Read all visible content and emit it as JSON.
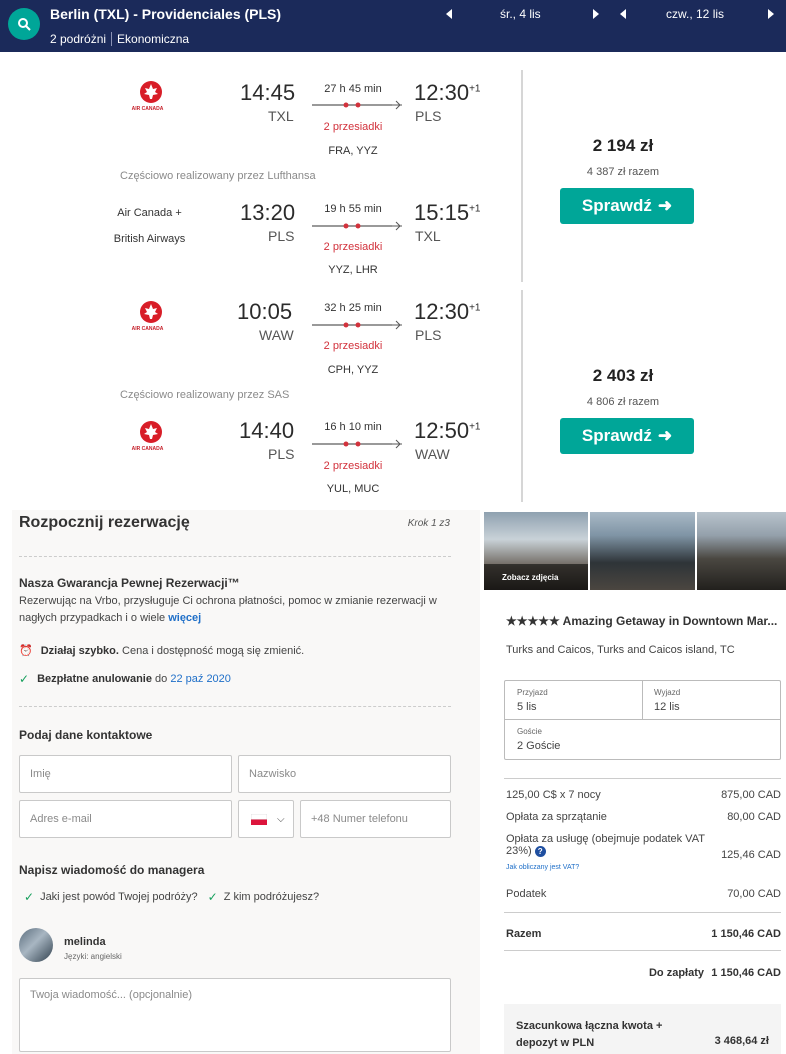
{
  "search": {
    "route": "Berlin (TXL) - Providenciales (PLS)",
    "travelers": "2 podróżni",
    "cabin": "Ekonomiczna",
    "depart_date": "śr., 4 lis",
    "return_date": "czw., 12 lis"
  },
  "results": [
    {
      "operated_by": "Częściowo realizowany przez Lufthansa",
      "price": "2 194 zł",
      "price_total": "4 387 zł razem",
      "book_label": "Sprawdź",
      "outbound": {
        "airline_logo": "air-canada-logo",
        "airline_text": "AIR CANADA",
        "depart_time": "14:45",
        "depart_code": "TXL",
        "duration": "27 h 45 min",
        "stops": "2 przesiadki",
        "arrive_time": "12:30",
        "arrive_offset": "+1",
        "arrive_code": "PLS",
        "via": "FRA, YYZ"
      },
      "inbound": {
        "airline_name": "Air Canada +",
        "airline_name2": "British Airways",
        "depart_time": "13:20",
        "depart_code": "PLS",
        "duration": "19 h 55 min",
        "stops": "2 przesiadki",
        "arrive_time": "15:15",
        "arrive_offset": "+1",
        "arrive_code": "TXL",
        "via": "YYZ, LHR"
      }
    },
    {
      "operated_by": "Częściowo realizowany przez SAS",
      "price": "2 403 zł",
      "price_total": "4 806 zł razem",
      "book_label": "Sprawdź",
      "outbound": {
        "airline_logo": "air-canada-logo",
        "airline_text": "AIR CANADA",
        "depart_time": "10:05",
        "depart_code": "WAW",
        "duration": "32 h 25 min",
        "stops": "2 przesiadki",
        "arrive_time": "12:30",
        "arrive_offset": "+1",
        "arrive_code": "PLS",
        "via": "CPH, YYZ"
      },
      "inbound": {
        "airline_logo": "air-canada-logo",
        "airline_text": "AIR CANADA",
        "depart_time": "14:40",
        "depart_code": "PLS",
        "duration": "16 h 10 min",
        "stops": "2 przesiadki",
        "arrive_time": "12:50",
        "arrive_offset": "+1",
        "arrive_code": "WAW",
        "via": "YUL, MUC"
      }
    }
  ],
  "booking": {
    "title": "Rozpocznij rezerwację",
    "step": "Krok 1 z3",
    "guarantee_title": "Nasza Gwarancja Pewnej Rezerwacji™",
    "guarantee_text": "Rezerwując na Vrbo, przysługuje Ci ochrona płatności, pomoc w zmianie rezerwacji w nagłych przypadkach i o wiele ",
    "guarantee_link": "więcej",
    "act_fast_bold": "Działaj szybko.",
    "act_fast_text": "Cena i dostępność mogą się zmienić.",
    "free_cancel_bold": "Bezpłatne anulowanie",
    "free_cancel_text": "do",
    "free_cancel_date": "22 paź 2020",
    "contact_title": "Podaj dane kontaktowe",
    "first_name_ph": "Imię",
    "last_name_ph": "Nazwisko",
    "email_ph": "Adres e-mail",
    "phone_ph": "+48 Numer telefonu",
    "message_title": "Napisz wiadomość do managera",
    "prompt1": "Jaki jest powód Twojej podróży?",
    "prompt2": "Z kim podróżujesz?",
    "manager_name": "melinda",
    "manager_lang": "Języki: angielski",
    "message_ph": "Twoja wiadomość... (opcjonalnie)"
  },
  "property": {
    "see_photos": "Zobacz zdjęcia",
    "title": "★★★★★ Amazing Getaway in Downtown Mar...",
    "location": "Turks and Caicos, Turks and Caicos island, TC",
    "checkin_label": "Przyjazd",
    "checkin": "5 lis",
    "checkout_label": "Wyjazd",
    "checkout": "12 lis",
    "guests_label": "Goście",
    "guests": "2 Goście",
    "fees": [
      {
        "label": "125,00 C$ x 7 nocy",
        "amount": "875,00 CAD"
      },
      {
        "label": "Opłata za sprzątanie",
        "amount": "80,00 CAD"
      },
      {
        "label": "Opłata za usługę (obejmuje podatek VAT",
        "label2": "23%)",
        "amount": "125,46 CAD"
      },
      {
        "label": "Podatek",
        "amount": "70,00 CAD"
      }
    ],
    "vat_link": "Jak obliczany jest VAT?",
    "total_label": "Razem",
    "total": "1 150,46 CAD",
    "due_label": "Do zapłaty",
    "due": "1 150,46 CAD",
    "deposit_label": "Szacunkowa łączna kwota + depozyt w PLN",
    "deposit": "3 468,64 zł"
  },
  "colors": {
    "navy": "#1b2a5a",
    "teal": "#00a698",
    "stops_red": "#d2323c",
    "link_blue": "#1f6fc8"
  }
}
